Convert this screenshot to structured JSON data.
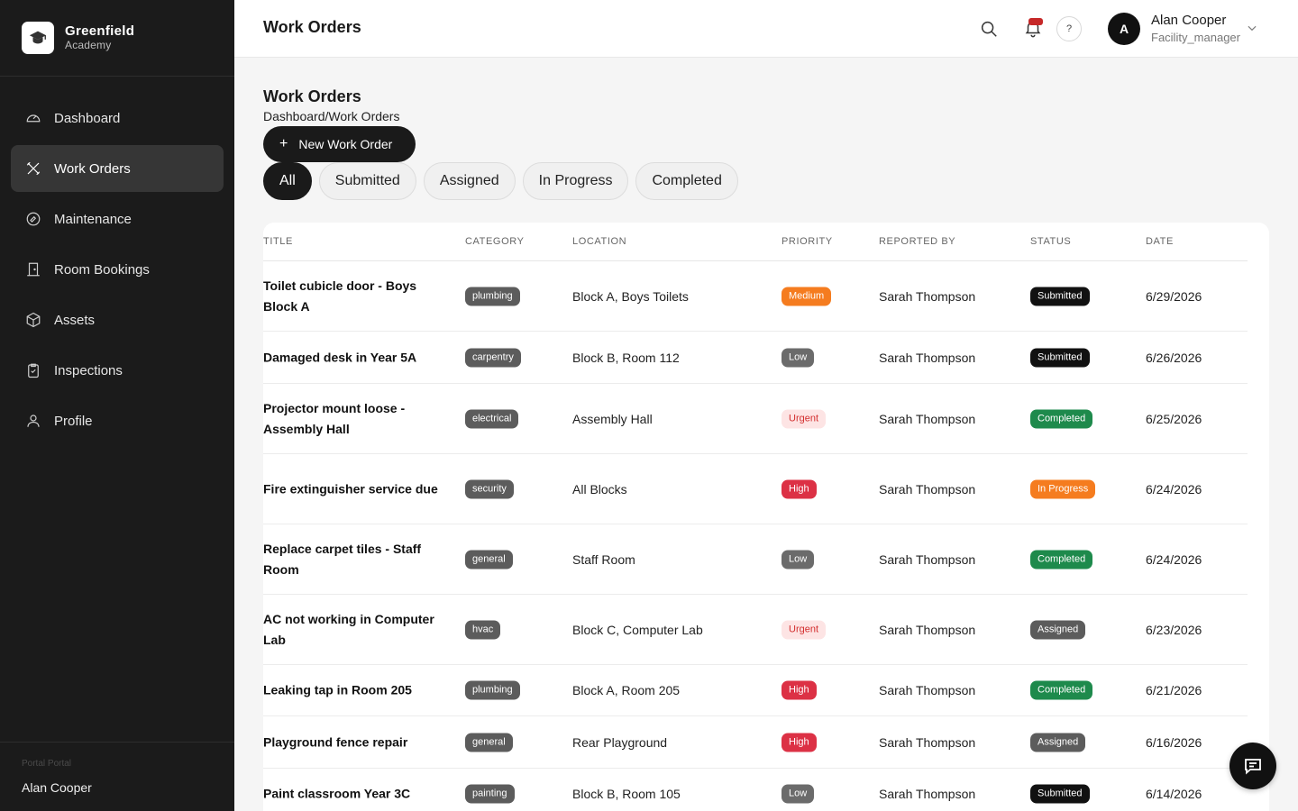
{
  "brand": {
    "name": "Greenfield",
    "sub": "Academy",
    "icon": "graduation-cap-icon"
  },
  "sidebar": {
    "items": [
      {
        "label": "Dashboard",
        "icon": "gauge-icon"
      },
      {
        "label": "Work Orders",
        "icon": "tools-icon",
        "active": true
      },
      {
        "label": "Maintenance",
        "icon": "wrench-globe-icon"
      },
      {
        "label": "Room Bookings",
        "icon": "door-icon"
      },
      {
        "label": "Assets",
        "icon": "box-icon"
      },
      {
        "label": "Inspections",
        "icon": "clipboard-check-icon"
      },
      {
        "label": "Profile",
        "icon": "user-icon"
      }
    ],
    "footer_label": "Portal Portal",
    "footer_user": "Alan Cooper"
  },
  "header": {
    "title": "Work Orders",
    "help": "?",
    "user": {
      "initial": "A",
      "name": "Alan Cooper",
      "role": "Facility_manager"
    }
  },
  "main": {
    "page_title": "Work Orders",
    "breadcrumb": "Dashboard/Work Orders",
    "new_button": "New Work Order",
    "filters": [
      "All",
      "Submitted",
      "Assigned",
      "In Progress",
      "Completed"
    ],
    "active_filter": "All"
  },
  "table": {
    "columns": [
      "Title",
      "Category",
      "Location",
      "Priority",
      "Reported By",
      "Status",
      "Date"
    ],
    "rows": [
      {
        "title": "Toilet cubicle door - Boys Block A",
        "category": "plumbing",
        "location": "Block A, Boys Toilets",
        "priority": "Medium",
        "reported_by": "Sarah Thompson",
        "status": "Submitted",
        "date": "6/29/2026"
      },
      {
        "title": "Damaged desk in Year 5A",
        "category": "carpentry",
        "location": "Block B, Room 112",
        "priority": "Low",
        "reported_by": "Sarah Thompson",
        "status": "Submitted",
        "date": "6/26/2026"
      },
      {
        "title": "Projector mount loose - Assembly Hall",
        "category": "electrical",
        "location": "Assembly Hall",
        "priority": "Urgent",
        "reported_by": "Sarah Thompson",
        "status": "Completed",
        "date": "6/25/2026"
      },
      {
        "title": "Fire extinguisher service due",
        "category": "security",
        "location": "All Blocks",
        "priority": "High",
        "reported_by": "Sarah Thompson",
        "status": "In Progress",
        "date": "6/24/2026"
      },
      {
        "title": "Replace carpet tiles - Staff Room",
        "category": "general",
        "location": "Staff Room",
        "priority": "Low",
        "reported_by": "Sarah Thompson",
        "status": "Completed",
        "date": "6/24/2026"
      },
      {
        "title": "AC not working in Computer Lab",
        "category": "hvac",
        "location": "Block C, Computer Lab",
        "priority": "Urgent",
        "reported_by": "Sarah Thompson",
        "status": "Assigned",
        "date": "6/23/2026"
      },
      {
        "title": "Leaking tap in Room 205",
        "category": "plumbing",
        "location": "Block A, Room 205",
        "priority": "High",
        "reported_by": "Sarah Thompson",
        "status": "Completed",
        "date": "6/21/2026"
      },
      {
        "title": "Playground fence repair",
        "category": "general",
        "location": "Rear Playground",
        "priority": "High",
        "reported_by": "Sarah Thompson",
        "status": "Assigned",
        "date": "6/16/2026"
      },
      {
        "title": "Paint classroom Year 3C",
        "category": "painting",
        "location": "Block B, Room 105",
        "priority": "Low",
        "reported_by": "Sarah Thompson",
        "status": "Submitted",
        "date": "6/14/2026"
      }
    ]
  },
  "colors": {
    "sidebar_bg": "#1b1b1b",
    "accent": "#1a1a1a",
    "medium": "#f57c1f",
    "high": "#dc3145",
    "urgent_text": "#d32f2f",
    "completed": "#1e8a4c"
  }
}
